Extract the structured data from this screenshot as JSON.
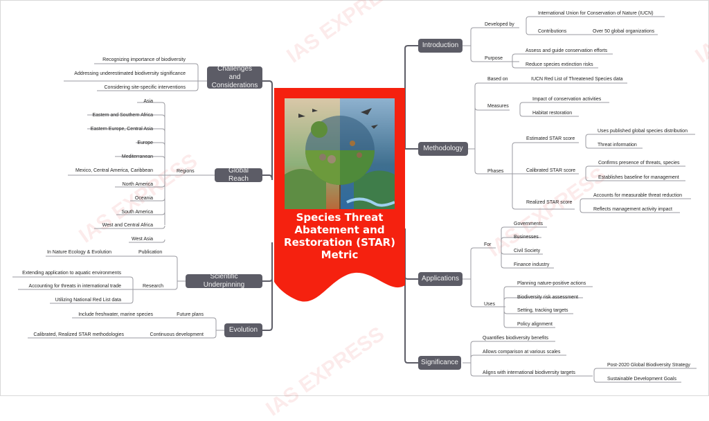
{
  "watermark": "IAS EXPRESS",
  "center": {
    "title": "Species Threat Abatement and Restoration (STAR) Metric",
    "image_alt": "illustration-biodiversity-globe",
    "color": "#f5210f"
  },
  "colors": {
    "node_bg": "#5c5c66",
    "node_text": "#f2f2f2",
    "link": "#9a9aa0"
  },
  "right": {
    "introduction": {
      "label": "Introduction",
      "developed_by": {
        "label": "Developed by",
        "items": [
          "International Union for Conservation of Nature (IUCN)"
        ],
        "contributions": {
          "label": "Contributions",
          "value": "Over 50 global organizations"
        }
      },
      "purpose": {
        "label": "Purpose",
        "items": [
          "Assess and guide conservation efforts",
          "Reduce species extinction risks"
        ]
      }
    },
    "methodology": {
      "label": "Methodology",
      "based_on": {
        "label": "Based on",
        "value": "IUCN Red List of Threatened Species data"
      },
      "measures": {
        "label": "Measures",
        "items": [
          "Impact of conservation activities",
          "Habitat restoration"
        ]
      },
      "phases": {
        "label": "Phases",
        "items": [
          {
            "label": "Estimated STAR score",
            "items": [
              "Uses published global species distribution",
              "Threat information"
            ]
          },
          {
            "label": "Calibrated STAR score",
            "items": [
              "Confirms presence of threats, species",
              "Establishes baseline for management"
            ]
          },
          {
            "label": "Realized STAR score",
            "items": [
              "Accounts for measurable threat reduction",
              "Reflects management activity impact"
            ]
          }
        ]
      }
    },
    "applications": {
      "label": "Applications",
      "for": {
        "label": "For",
        "items": [
          "Governments",
          "Businesses",
          "Civil Society",
          "Finance industry"
        ]
      },
      "uses": {
        "label": "Uses",
        "items": [
          "Planning nature-positive actions",
          "Biodiversity risk assessment",
          "Setting, tracking targets",
          "Policy alignment"
        ]
      }
    },
    "significance": {
      "label": "Significance",
      "items": [
        "Quantifies biodiversity benefits",
        "Allows comparison at various scales"
      ],
      "aligns": {
        "label": "Aligns with international biodiversity targets",
        "items": [
          "Post-2020 Global Biodiversity Strategy",
          "Sustainable Development Goals"
        ]
      }
    }
  },
  "left": {
    "challenges": {
      "label": "Challenges and Considerations",
      "items": [
        "Recognizing importance of biodiversity",
        "Addressing underestimated biodiversity significance",
        "Considering site-specific interventions"
      ]
    },
    "global_reach": {
      "label": "Global Reach",
      "regions": {
        "label": "Regions",
        "items": [
          "Asia",
          "Eastern and Southern Africa",
          "Eastern Europe, Central Asia",
          "Europe",
          "Mediterranean",
          "Mexico, Central America, Caribbean",
          "North America",
          "Oceania",
          "South America",
          "West and Central Africa",
          "West Asia"
        ]
      }
    },
    "scientific": {
      "label": "Scientific Underpinning",
      "publication": {
        "label": "Publication",
        "value": "In Nature Ecology & Evolution"
      },
      "research": {
        "label": "Research",
        "items": [
          "Extending application to aquatic environments",
          "Accounting for threats in international trade",
          "Utilizing National Red List data"
        ]
      }
    },
    "evolution": {
      "label": "Evolution",
      "future": {
        "label": "Future plans",
        "value": "Include freshwater, marine species"
      },
      "continuous": {
        "label": "Continuous development",
        "value": "Calibrated, Realized STAR methodologies"
      }
    }
  }
}
